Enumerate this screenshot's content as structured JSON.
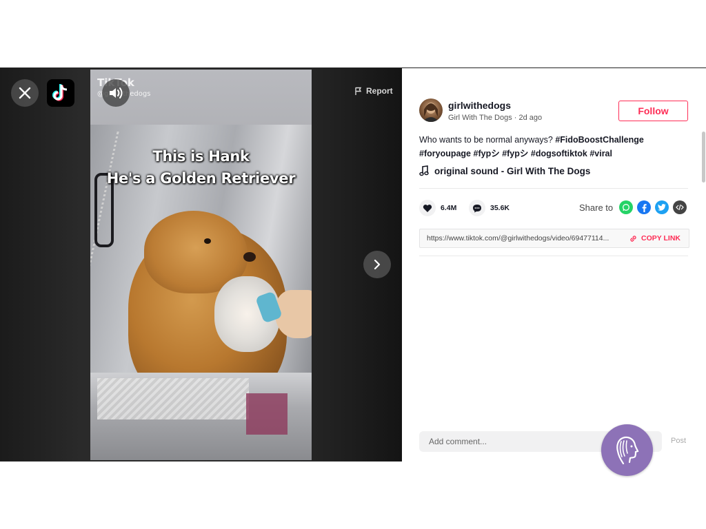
{
  "viewer": {
    "close_icon": "close-icon",
    "logo_icon": "tiktok-logo-icon",
    "sound_icon": "speaker-volume-icon",
    "report_label": "Report",
    "next_icon": "chevron-right-icon"
  },
  "video": {
    "watermark_brand": "TikTok",
    "watermark_user": "@girlwithedogs",
    "caption_line1": "This is Hank",
    "caption_line2": "He's a Golden Retriever"
  },
  "post": {
    "username": "girlwithedogs",
    "display_name": "Girl With The Dogs",
    "time_ago": "2d ago",
    "follow_label": "Follow",
    "description_text": "Who wants to be normal anyways? ",
    "hashtags_line1": [
      "#FidoBoostChallenge"
    ],
    "hashtags_line2": [
      "#foryoupage",
      "#fypシ",
      "#fypシ",
      "#dogsoftiktok",
      "#viral"
    ],
    "sound": "original sound - Girl With The Dogs",
    "likes": "6.4M",
    "comments": "35.6K",
    "share_label": "Share to",
    "share_targets": [
      "whatsapp",
      "facebook",
      "twitter",
      "embed"
    ],
    "link_url": "https://www.tiktok.com/@girlwithedogs/video/69477114...",
    "copy_link_label": "COPY LINK",
    "comment_placeholder": "Add comment...",
    "post_label": "Post"
  },
  "colors": {
    "accent": "#fe2c55",
    "whatsapp": "#25d366",
    "facebook": "#1877f2",
    "twitter": "#1da1f2",
    "embed": "#444444",
    "extension": "#8d72b7"
  }
}
